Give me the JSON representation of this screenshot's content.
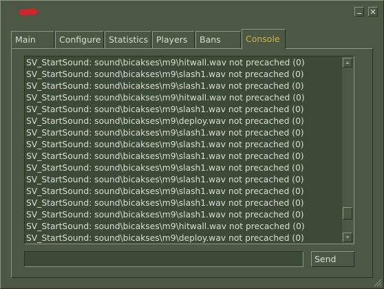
{
  "colors": {
    "logo": "#d0252a",
    "active_tab": "#c4b550",
    "text": "#d8ded3",
    "window_bg": "#4c5844",
    "field_bg": "#3e4a38"
  },
  "titlebar": {
    "logo_icon": "red-logo-icon",
    "minimize_icon": "minimize-icon",
    "close_icon": "close-icon"
  },
  "tabs": [
    {
      "label": "Main",
      "active": false
    },
    {
      "label": "Configure",
      "active": false
    },
    {
      "label": "Statistics",
      "active": false
    },
    {
      "label": "Players",
      "active": false
    },
    {
      "label": "Bans",
      "active": false
    },
    {
      "label": "Console",
      "active": true
    }
  ],
  "console": {
    "lines": [
      "SV_StartSound: sound\\bicakses\\m9\\hitwall.wav not precached (0)",
      "SV_StartSound: sound\\bicakses\\m9\\slash1.wav not precached (0)",
      "SV_StartSound: sound\\bicakses\\m9\\slash1.wav not precached (0)",
      "SV_StartSound: sound\\bicakses\\m9\\hitwall.wav not precached (0)",
      "SV_StartSound: sound\\bicakses\\m9\\slash1.wav not precached (0)",
      "SV_StartSound: sound\\bicakses\\m9\\deploy.wav not precached (0)",
      "SV_StartSound: sound\\bicakses\\m9\\slash1.wav not precached (0)",
      "SV_StartSound: sound\\bicakses\\m9\\slash1.wav not precached (0)",
      "SV_StartSound: sound\\bicakses\\m9\\slash1.wav not precached (0)",
      "SV_StartSound: sound\\bicakses\\m9\\slash1.wav not precached (0)",
      "SV_StartSound: sound\\bicakses\\m9\\slash1.wav not precached (0)",
      "SV_StartSound: sound\\bicakses\\m9\\slash1.wav not precached (0)",
      "SV_StartSound: sound\\bicakses\\m9\\slash1.wav not precached (0)",
      "SV_StartSound: sound\\bicakses\\m9\\slash1.wav not precached (0)",
      "SV_StartSound: sound\\bicakses\\m9\\hitwall.wav not precached (0)",
      "SV_StartSound: sound\\bicakses\\m9\\deploy.wav not precached (0)",
      "SV_StartSound: sound\\bicakses\\m9\\slash1.wav not precached (0)"
    ],
    "scroll_position": 0.92
  },
  "command": {
    "value": "",
    "placeholder": "",
    "send_label": "Send"
  }
}
